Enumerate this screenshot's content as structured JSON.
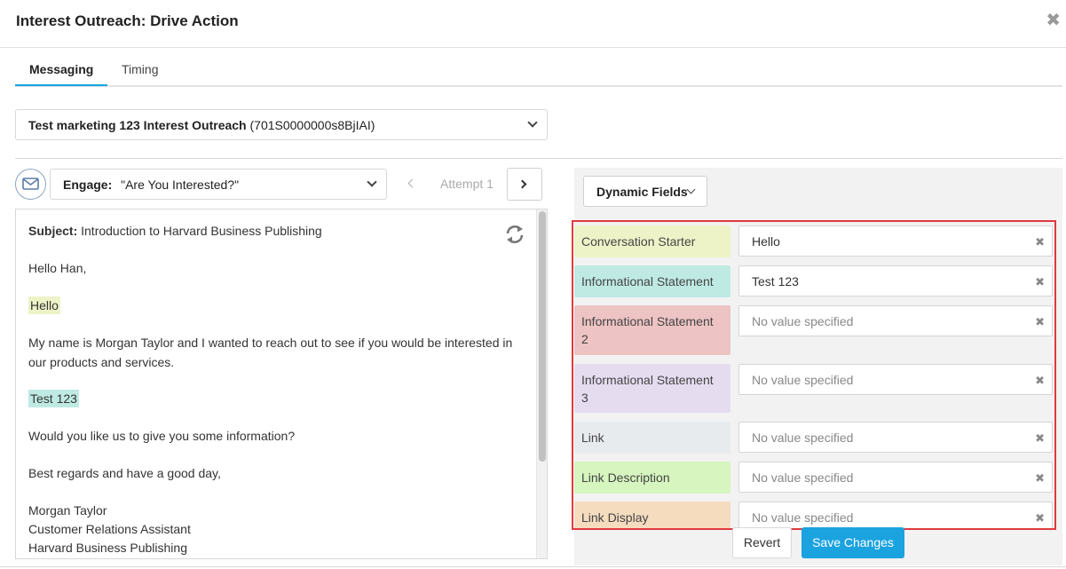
{
  "dialog": {
    "title": "Interest Outreach: Drive Action",
    "close_icon": "close-icon"
  },
  "tabs": [
    {
      "label": "Messaging",
      "active": true
    },
    {
      "label": "Timing",
      "active": false
    }
  ],
  "campaign": {
    "name": "Test marketing 123 Interest Outreach",
    "id": "(701S0000000s8BjIAI)"
  },
  "engage": {
    "label": "Engage:",
    "value": "\"Are You Interested?\"",
    "attempt": "Attempt 1"
  },
  "email": {
    "subject_label": "Subject:",
    "subject": "Introduction to Harvard Business Publishing",
    "greeting": "Hello Han,",
    "starter": "Hello",
    "body1": "My name is Morgan Taylor and I wanted to reach out to see if you would be interested in",
    "body2": "our products and services.",
    "statement": "Test 123",
    "question": "Would you like us to give you some information?",
    "closing": "Best regards and have a good day,",
    "sig_name": "Morgan Taylor",
    "sig_title": "Customer Relations Assistant",
    "sig_company": "Harvard Business Publishing"
  },
  "dynamic_fields": {
    "button_label": "Dynamic Fields",
    "items": [
      {
        "label": "Conversation Starter",
        "value": "Hello",
        "placeholder": false,
        "color": "#eef3c7"
      },
      {
        "label": "Informational Statement",
        "value": "Test 123",
        "placeholder": false,
        "color": "#bfeae4"
      },
      {
        "label": "Informational Statement 2",
        "value": "No value specified",
        "placeholder": true,
        "color": "#edc3c3"
      },
      {
        "label": "Informational Statement 3",
        "value": "No value specified",
        "placeholder": true,
        "color": "#e5dcf0"
      },
      {
        "label": "Link",
        "value": "No value specified",
        "placeholder": true,
        "color": "#e8ebee"
      },
      {
        "label": "Link Description",
        "value": "No value specified",
        "placeholder": true,
        "color": "#d6f5bf"
      },
      {
        "label": "Link Display",
        "value": "No value specified",
        "placeholder": true,
        "color": "#f5dcbf"
      }
    ]
  },
  "actions": {
    "revert": "Revert",
    "save": "Save Changes"
  },
  "colors": {
    "accent": "#1ba3e0",
    "highlight_border": "#e03a3e"
  }
}
